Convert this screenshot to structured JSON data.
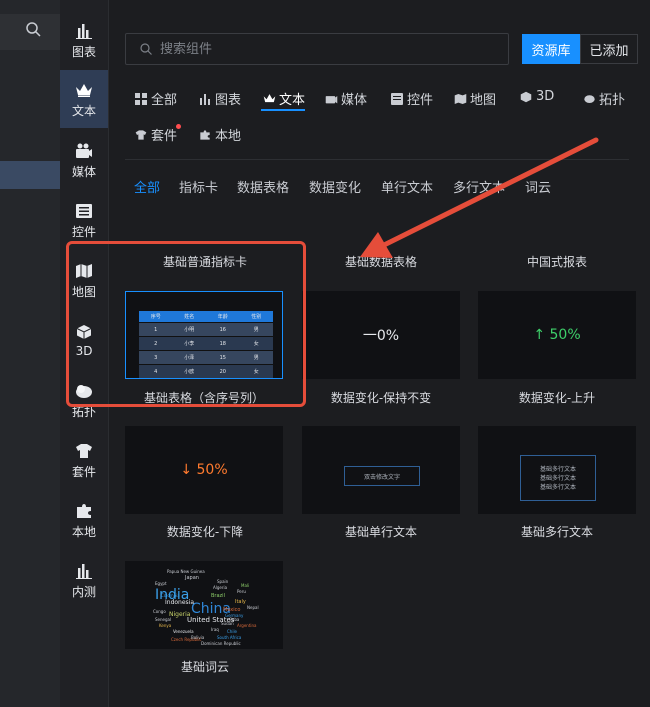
{
  "rail": [
    {
      "label": "图表",
      "icon": "bar-chart-icon"
    },
    {
      "label": "文本",
      "icon": "crown-icon",
      "active": true
    },
    {
      "label": "媒体",
      "icon": "media-icon"
    },
    {
      "label": "控件",
      "icon": "list-icon"
    },
    {
      "label": "地图",
      "icon": "map-icon"
    },
    {
      "label": "3D",
      "icon": "cube-icon"
    },
    {
      "label": "拓扑",
      "icon": "topology-icon"
    },
    {
      "label": "套件",
      "icon": "shirt-icon"
    },
    {
      "label": "本地",
      "icon": "puzzle-icon"
    },
    {
      "label": "内测",
      "icon": "bar-chart-icon"
    }
  ],
  "search": {
    "placeholder": "搜索组件"
  },
  "buttons": {
    "library": "资源库",
    "added": "已添加"
  },
  "categories": [
    "全部",
    "图表",
    "文本",
    "媒体",
    "控件",
    "地图",
    "3D",
    "拓扑",
    "套件",
    "本地"
  ],
  "subtabs": [
    "全部",
    "指标卡",
    "数据表格",
    "数据变化",
    "单行文本",
    "多行文本",
    "词云"
  ],
  "cards": [
    {
      "label": "基础普通指标卡"
    },
    {
      "label": "基础数据表格"
    },
    {
      "label": "中国式报表"
    },
    {
      "label": "基础表格（含序号列）"
    },
    {
      "label": "数据变化-保持不变",
      "value": "一0%"
    },
    {
      "label": "数据变化-上升",
      "value": "↑ 50%"
    },
    {
      "label": "数据变化-下降",
      "value": "↓ 50%"
    },
    {
      "label": "基础单行文本",
      "text": "双击修改文字"
    },
    {
      "label": "基础多行文本",
      "lines": [
        "基础多行文本",
        "基础多行文本",
        "基础多行文本"
      ]
    },
    {
      "label": "基础词云"
    }
  ],
  "tiny_table": {
    "headers": [
      "序号",
      "姓名",
      "年龄",
      "性别"
    ],
    "rows": [
      [
        "1",
        "小明",
        "16",
        "男"
      ],
      [
        "2",
        "小李",
        "18",
        "女"
      ],
      [
        "3",
        "小泽",
        "15",
        "男"
      ],
      [
        "4",
        "小欧",
        "20",
        "女"
      ]
    ]
  },
  "wordcloud": [
    "India",
    "China",
    "United States",
    "Indonesia",
    "Nigeria",
    "Brazil",
    "Mexico",
    "Japan",
    "Algeria",
    "Italy",
    "Iraq",
    "Chile",
    "Venezuela",
    "Spain",
    "Cuba",
    "Peru",
    "Kenya",
    "Mali",
    "Egypt",
    "Congo",
    "Sudan",
    "Germany",
    "Argentina",
    "Nepal",
    "Czech Republic",
    "Dominican Republic",
    "Papua New Guinea",
    "Colombia",
    "Senegal",
    "Bolivia",
    "South Africa"
  ],
  "colors": {
    "accent": "#1890ff",
    "annotation": "#e54d3a",
    "up": "#3ecf6a",
    "down": "#ff7a2e"
  }
}
